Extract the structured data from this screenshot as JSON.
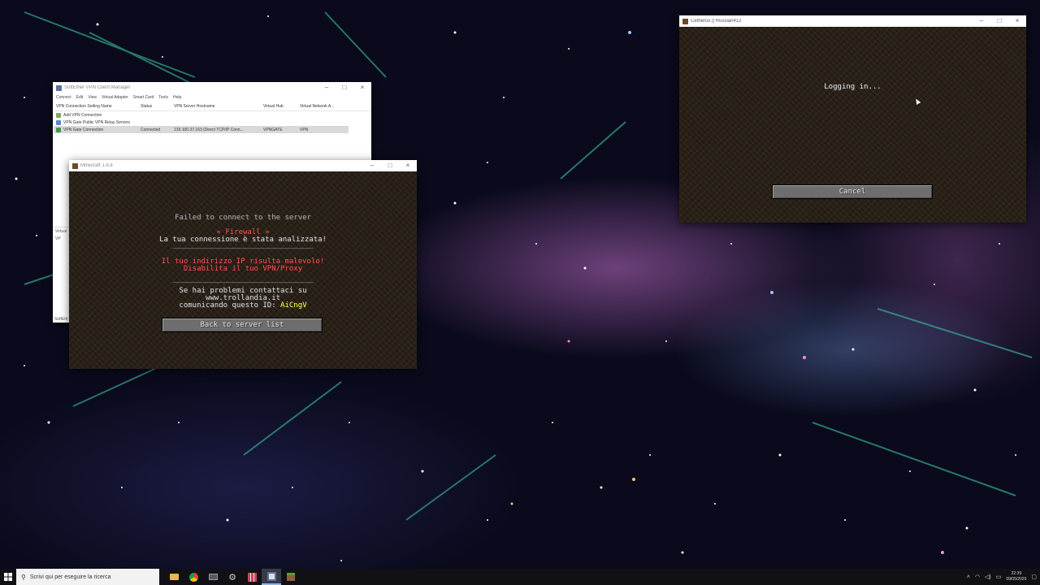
{
  "softether": {
    "title": "SoftEther VPN Client Manager",
    "menu": [
      "Connect",
      "Edit",
      "View",
      "Virtual Adapter",
      "Smart Card",
      "Tools",
      "Help"
    ],
    "columns": [
      "VPN Connection Setting Name",
      "Status",
      "VPN Server Hostname",
      "Virtual Hub",
      "Virtual Network A..."
    ],
    "rows": [
      {
        "name": "Add VPN Connection",
        "status": "",
        "host": "",
        "hub": "",
        "adapter": ""
      },
      {
        "name": "VPN Gate Public VPN Relay Servers",
        "status": "",
        "host": "",
        "hub": "",
        "adapter": ""
      },
      {
        "name": "VPN Gate Connection",
        "status": "Connected",
        "host": "219.100.37.163 (Direct TCP/IP Conn...",
        "hub": "VPNGATE",
        "adapter": "VPN"
      }
    ],
    "lower_header": "Virtual",
    "lower_item": "VP",
    "status_bar": "SoftEth"
  },
  "mc_disconnect": {
    "title": "Minecraft 1.8.8",
    "heading": "Failed to connect to the server",
    "firewall": "« Firewall »",
    "analyzed": "La tua connessione è stata analizzata!",
    "separator1": "________________________________",
    "malicious": "Il tuo indirizzo IP risulta malevolo!",
    "disable": "Disabilita il tuo VPN/Proxy",
    "separator2": "________________________________",
    "contact": "Se hai problemi contattaci su",
    "site": "www.trollandia.it",
    "id_prefix": "comunicando questo ID: ",
    "id_value": "AiCngV",
    "back_button": "Back to server list"
  },
  "mc_login": {
    "title": "Cetherus || Russian412",
    "status": "Logging in...",
    "cancel_button": "Cancel"
  },
  "taskbar": {
    "search_placeholder": "Scrivi qui per eseguire la ricerca",
    "time": "22:39",
    "date": "09/05/2020"
  }
}
